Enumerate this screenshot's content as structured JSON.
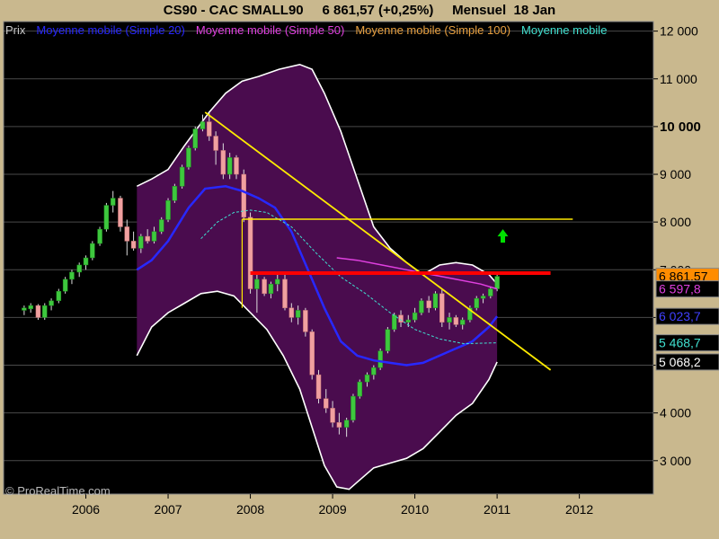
{
  "title": "CS90 - CAC SMALL90     6 861,57 (+0,25%)     Mensuel  18 Jan",
  "legend": [
    {
      "label": "Prix",
      "color": "#c8c8c8"
    },
    {
      "label": "Moyenne mobile (Simple 20)",
      "color": "#2828ff"
    },
    {
      "label": "Moyenne mobile (Simple 50)",
      "color": "#e040e0"
    },
    {
      "label": "Moyenne mobile (Simple 100)",
      "color": "#e8a040"
    },
    {
      "label": "Moyenne mobile",
      "color": "#40e0d0"
    }
  ],
  "copyright": "© ProRealTime.com",
  "chart_data": {
    "type": "candlestick",
    "title": "CS90 - CAC SMALL90",
    "period": "Mensuel",
    "last_value": "6 861,57",
    "change": "+0,25%",
    "x_ticks": [
      "2006",
      "2007",
      "2008",
      "2009",
      "2010",
      "2011",
      "2012"
    ],
    "y_ticks": [
      "3 000",
      "4 000",
      "5 000",
      "6 000",
      "7 000",
      "8 000",
      "9 000",
      "10 000",
      "11 000",
      "12 000"
    ],
    "y_tick_values": [
      3000,
      4000,
      5000,
      6000,
      7000,
      8000,
      9000,
      10000,
      11000,
      12000
    ],
    "y_bold_ticks": [
      10000
    ],
    "ylim": [
      2300,
      12200
    ],
    "xlim": [
      2005.0,
      2012.9
    ],
    "price_tags": [
      {
        "label": "6 861,57",
        "value": 6862,
        "bg": "#ff8c00",
        "color": "#000"
      },
      {
        "label": "6 597,8",
        "value": 6598,
        "bg": "#000",
        "color": "#e040e0"
      },
      {
        "label": "6 023,7",
        "value": 6024,
        "bg": "#000",
        "color": "#4040ff"
      },
      {
        "label": "5 468,7",
        "value": 5469,
        "bg": "#000",
        "color": "#40e0d0"
      },
      {
        "label": "5 068,2",
        "value": 5068,
        "bg": "#000",
        "color": "#fff"
      }
    ],
    "candles": [
      {
        "x": 2005.25,
        "o": 6150,
        "h": 6250,
        "l": 6050,
        "c": 6200
      },
      {
        "x": 2005.33,
        "o": 6180,
        "h": 6300,
        "l": 6100,
        "c": 6250
      },
      {
        "x": 2005.42,
        "o": 6250,
        "h": 6280,
        "l": 5950,
        "c": 6000
      },
      {
        "x": 2005.5,
        "o": 6000,
        "h": 6300,
        "l": 5950,
        "c": 6250
      },
      {
        "x": 2005.58,
        "o": 6250,
        "h": 6400,
        "l": 6150,
        "c": 6350
      },
      {
        "x": 2005.67,
        "o": 6350,
        "h": 6600,
        "l": 6300,
        "c": 6550
      },
      {
        "x": 2005.75,
        "o": 6550,
        "h": 6850,
        "l": 6500,
        "c": 6800
      },
      {
        "x": 2005.83,
        "o": 6800,
        "h": 7000,
        "l": 6700,
        "c": 6950
      },
      {
        "x": 2005.92,
        "o": 6950,
        "h": 7150,
        "l": 6850,
        "c": 7100
      },
      {
        "x": 2006.0,
        "o": 7100,
        "h": 7300,
        "l": 7000,
        "c": 7250
      },
      {
        "x": 2006.08,
        "o": 7250,
        "h": 7600,
        "l": 7200,
        "c": 7550
      },
      {
        "x": 2006.17,
        "o": 7550,
        "h": 7900,
        "l": 7500,
        "c": 7850
      },
      {
        "x": 2006.25,
        "o": 7850,
        "h": 8400,
        "l": 7800,
        "c": 8350
      },
      {
        "x": 2006.33,
        "o": 8350,
        "h": 8650,
        "l": 8200,
        "c": 8500
      },
      {
        "x": 2006.42,
        "o": 8500,
        "h": 8550,
        "l": 7800,
        "c": 7900
      },
      {
        "x": 2006.5,
        "o": 7900,
        "h": 8050,
        "l": 7300,
        "c": 7600
      },
      {
        "x": 2006.58,
        "o": 7600,
        "h": 7800,
        "l": 7400,
        "c": 7450
      },
      {
        "x": 2006.67,
        "o": 7450,
        "h": 7750,
        "l": 7350,
        "c": 7700
      },
      {
        "x": 2006.75,
        "o": 7700,
        "h": 7850,
        "l": 7550,
        "c": 7600
      },
      {
        "x": 2006.83,
        "o": 7600,
        "h": 7900,
        "l": 7550,
        "c": 7800
      },
      {
        "x": 2006.92,
        "o": 7800,
        "h": 8100,
        "l": 7750,
        "c": 8050
      },
      {
        "x": 2007.0,
        "o": 8050,
        "h": 8500,
        "l": 8000,
        "c": 8450
      },
      {
        "x": 2007.08,
        "o": 8450,
        "h": 8800,
        "l": 8400,
        "c": 8750
      },
      {
        "x": 2007.17,
        "o": 8750,
        "h": 9200,
        "l": 8700,
        "c": 9150
      },
      {
        "x": 2007.25,
        "o": 9150,
        "h": 9600,
        "l": 9100,
        "c": 9550
      },
      {
        "x": 2007.33,
        "o": 9550,
        "h": 10000,
        "l": 9500,
        "c": 9950
      },
      {
        "x": 2007.42,
        "o": 9950,
        "h": 10250,
        "l": 9900,
        "c": 10100
      },
      {
        "x": 2007.5,
        "o": 10100,
        "h": 10280,
        "l": 9700,
        "c": 9800
      },
      {
        "x": 2007.58,
        "o": 9800,
        "h": 9900,
        "l": 9200,
        "c": 9500
      },
      {
        "x": 2007.67,
        "o": 9500,
        "h": 9650,
        "l": 8900,
        "c": 9000
      },
      {
        "x": 2007.75,
        "o": 9000,
        "h": 9450,
        "l": 8900,
        "c": 9350
      },
      {
        "x": 2007.83,
        "o": 9350,
        "h": 9400,
        "l": 8900,
        "c": 9000
      },
      {
        "x": 2007.92,
        "o": 9000,
        "h": 9100,
        "l": 8000,
        "c": 8100
      },
      {
        "x": 2008.0,
        "o": 8100,
        "h": 8200,
        "l": 6500,
        "c": 6600
      },
      {
        "x": 2008.08,
        "o": 6600,
        "h": 6900,
        "l": 6100,
        "c": 6800
      },
      {
        "x": 2008.17,
        "o": 6800,
        "h": 6850,
        "l": 6450,
        "c": 6500
      },
      {
        "x": 2008.25,
        "o": 6500,
        "h": 6750,
        "l": 6400,
        "c": 6700
      },
      {
        "x": 2008.33,
        "o": 6700,
        "h": 6900,
        "l": 6550,
        "c": 6800
      },
      {
        "x": 2008.42,
        "o": 6800,
        "h": 6950,
        "l": 6150,
        "c": 6200
      },
      {
        "x": 2008.5,
        "o": 6200,
        "h": 6300,
        "l": 5900,
        "c": 6000
      },
      {
        "x": 2008.58,
        "o": 6000,
        "h": 6250,
        "l": 5850,
        "c": 6150
      },
      {
        "x": 2008.67,
        "o": 6150,
        "h": 6200,
        "l": 5600,
        "c": 5700
      },
      {
        "x": 2008.75,
        "o": 5700,
        "h": 5750,
        "l": 4700,
        "c": 4800
      },
      {
        "x": 2008.83,
        "o": 4800,
        "h": 4900,
        "l": 4200,
        "c": 4300
      },
      {
        "x": 2008.92,
        "o": 4300,
        "h": 4500,
        "l": 4000,
        "c": 4100
      },
      {
        "x": 2009.0,
        "o": 4100,
        "h": 4250,
        "l": 3700,
        "c": 3800
      },
      {
        "x": 2009.08,
        "o": 3800,
        "h": 4000,
        "l": 3550,
        "c": 3700
      },
      {
        "x": 2009.17,
        "o": 3700,
        "h": 3900,
        "l": 3500,
        "c": 3850
      },
      {
        "x": 2009.25,
        "o": 3850,
        "h": 4400,
        "l": 3800,
        "c": 4350
      },
      {
        "x": 2009.33,
        "o": 4350,
        "h": 4700,
        "l": 4300,
        "c": 4650
      },
      {
        "x": 2009.42,
        "o": 4650,
        "h": 4850,
        "l": 4550,
        "c": 4800
      },
      {
        "x": 2009.5,
        "o": 4800,
        "h": 5000,
        "l": 4700,
        "c": 4950
      },
      {
        "x": 2009.58,
        "o": 4950,
        "h": 5350,
        "l": 4900,
        "c": 5300
      },
      {
        "x": 2009.67,
        "o": 5300,
        "h": 5800,
        "l": 5250,
        "c": 5750
      },
      {
        "x": 2009.75,
        "o": 5750,
        "h": 6100,
        "l": 5700,
        "c": 6050
      },
      {
        "x": 2009.83,
        "o": 6050,
        "h": 6150,
        "l": 5800,
        "c": 5900
      },
      {
        "x": 2009.92,
        "o": 5900,
        "h": 6050,
        "l": 5800,
        "c": 5950
      },
      {
        "x": 2010.0,
        "o": 5950,
        "h": 6200,
        "l": 5900,
        "c": 6100
      },
      {
        "x": 2010.08,
        "o": 6100,
        "h": 6400,
        "l": 6050,
        "c": 6350
      },
      {
        "x": 2010.17,
        "o": 6350,
        "h": 6450,
        "l": 6100,
        "c": 6200
      },
      {
        "x": 2010.25,
        "o": 6200,
        "h": 6550,
        "l": 6150,
        "c": 6500
      },
      {
        "x": 2010.33,
        "o": 6500,
        "h": 6600,
        "l": 5800,
        "c": 5900
      },
      {
        "x": 2010.42,
        "o": 5900,
        "h": 6100,
        "l": 5750,
        "c": 6000
      },
      {
        "x": 2010.5,
        "o": 6000,
        "h": 6050,
        "l": 5800,
        "c": 5850
      },
      {
        "x": 2010.58,
        "o": 5850,
        "h": 6000,
        "l": 5750,
        "c": 5950
      },
      {
        "x": 2010.67,
        "o": 5950,
        "h": 6250,
        "l": 5900,
        "c": 6200
      },
      {
        "x": 2010.75,
        "o": 6200,
        "h": 6450,
        "l": 6150,
        "c": 6400
      },
      {
        "x": 2010.83,
        "o": 6400,
        "h": 6500,
        "l": 6300,
        "c": 6450
      },
      {
        "x": 2010.92,
        "o": 6450,
        "h": 6650,
        "l": 6400,
        "c": 6600
      },
      {
        "x": 2011.0,
        "o": 6600,
        "h": 6950,
        "l": 6550,
        "c": 6862
      }
    ],
    "series": [
      {
        "name": "Moyenne mobile (Simple 20)",
        "color": "#2828ff",
        "width": 2.5,
        "points": [
          [
            2006.62,
            7000
          ],
          [
            2006.8,
            7200
          ],
          [
            2007.0,
            7600
          ],
          [
            2007.25,
            8300
          ],
          [
            2007.45,
            8700
          ],
          [
            2007.7,
            8750
          ],
          [
            2007.9,
            8650
          ],
          [
            2008.1,
            8500
          ],
          [
            2008.3,
            8300
          ],
          [
            2008.5,
            7800
          ],
          [
            2008.7,
            7000
          ],
          [
            2008.9,
            6200
          ],
          [
            2009.1,
            5500
          ],
          [
            2009.3,
            5200
          ],
          [
            2009.5,
            5100
          ],
          [
            2009.7,
            5050
          ],
          [
            2009.9,
            5000
          ],
          [
            2010.1,
            5050
          ],
          [
            2010.3,
            5200
          ],
          [
            2010.5,
            5350
          ],
          [
            2010.7,
            5500
          ],
          [
            2010.9,
            5800
          ],
          [
            2011.0,
            6024
          ]
        ]
      },
      {
        "name": "Moyenne mobile (Simple 50)",
        "color": "#e040e0",
        "width": 1.5,
        "points": [
          [
            2009.05,
            7250
          ],
          [
            2009.3,
            7200
          ],
          [
            2009.6,
            7100
          ],
          [
            2009.9,
            7000
          ],
          [
            2010.2,
            6900
          ],
          [
            2010.5,
            6800
          ],
          [
            2010.8,
            6700
          ],
          [
            2011.0,
            6598
          ]
        ]
      },
      {
        "name": "Moyenne mobile",
        "color": "#40e0d0",
        "width": 1,
        "dashed": true,
        "points": [
          [
            2007.4,
            7650
          ],
          [
            2007.6,
            8000
          ],
          [
            2007.8,
            8200
          ],
          [
            2008.0,
            8250
          ],
          [
            2008.2,
            8200
          ],
          [
            2008.5,
            7900
          ],
          [
            2008.8,
            7350
          ],
          [
            2009.1,
            6850
          ],
          [
            2009.4,
            6500
          ],
          [
            2009.7,
            6100
          ],
          [
            2010.0,
            5750
          ],
          [
            2010.3,
            5550
          ],
          [
            2010.6,
            5450
          ],
          [
            2011.0,
            5469
          ]
        ]
      }
    ],
    "bollinger": {
      "upper": [
        [
          2006.62,
          8750
        ],
        [
          2006.8,
          8900
        ],
        [
          2007.0,
          9100
        ],
        [
          2007.2,
          9600
        ],
        [
          2007.5,
          10300
        ],
        [
          2007.7,
          10700
        ],
        [
          2007.9,
          10950
        ],
        [
          2008.1,
          11050
        ],
        [
          2008.35,
          11200
        ],
        [
          2008.6,
          11300
        ],
        [
          2008.75,
          11200
        ],
        [
          2008.9,
          10700
        ],
        [
          2009.1,
          9900
        ],
        [
          2009.3,
          8900
        ],
        [
          2009.5,
          7900
        ],
        [
          2009.7,
          7450
        ],
        [
          2009.9,
          7150
        ],
        [
          2010.1,
          6900
        ],
        [
          2010.3,
          7100
        ],
        [
          2010.5,
          7150
        ],
        [
          2010.7,
          7100
        ],
        [
          2010.9,
          6900
        ],
        [
          2011.0,
          6700
        ]
      ],
      "lower": [
        [
          2011.0,
          5068
        ],
        [
          2010.9,
          4700
        ],
        [
          2010.7,
          4200
        ],
        [
          2010.5,
          3950
        ],
        [
          2010.3,
          3600
        ],
        [
          2010.1,
          3250
        ],
        [
          2009.9,
          3050
        ],
        [
          2009.7,
          2950
        ],
        [
          2009.5,
          2850
        ],
        [
          2009.3,
          2550
        ],
        [
          2009.2,
          2400
        ],
        [
          2009.05,
          2450
        ],
        [
          2008.9,
          2900
        ],
        [
          2008.75,
          3700
        ],
        [
          2008.6,
          4500
        ],
        [
          2008.4,
          5200
        ],
        [
          2008.2,
          5750
        ],
        [
          2008.0,
          6100
        ],
        [
          2007.8,
          6450
        ],
        [
          2007.6,
          6550
        ],
        [
          2007.4,
          6500
        ],
        [
          2007.2,
          6300
        ],
        [
          2007.0,
          6100
        ],
        [
          2006.8,
          5800
        ],
        [
          2006.62,
          5200
        ]
      ],
      "fill": "#4a0c4e",
      "stroke": "#ffffff"
    },
    "trendlines": [
      {
        "from": [
          2007.45,
          10300
        ],
        "to": [
          2011.65,
          4900
        ],
        "color": "#ffeb00",
        "width": 1.8
      },
      {
        "from": [
          2007.9,
          8060
        ],
        "to": [
          2011.92,
          8060
        ],
        "color": "#ffeb00",
        "width": 1.5
      },
      {
        "from": [
          2007.9,
          8060
        ],
        "to": [
          2007.9,
          6200
        ],
        "color": "#ffeb00",
        "width": 1.2
      },
      {
        "from": [
          2008.0,
          6930
        ],
        "to": [
          2011.65,
          6930
        ],
        "color": "#ff0000",
        "width": 4
      }
    ],
    "annotations": [
      {
        "type": "arrow-up",
        "x": 2011.07,
        "y": 7700,
        "color": "#00e000"
      }
    ]
  }
}
